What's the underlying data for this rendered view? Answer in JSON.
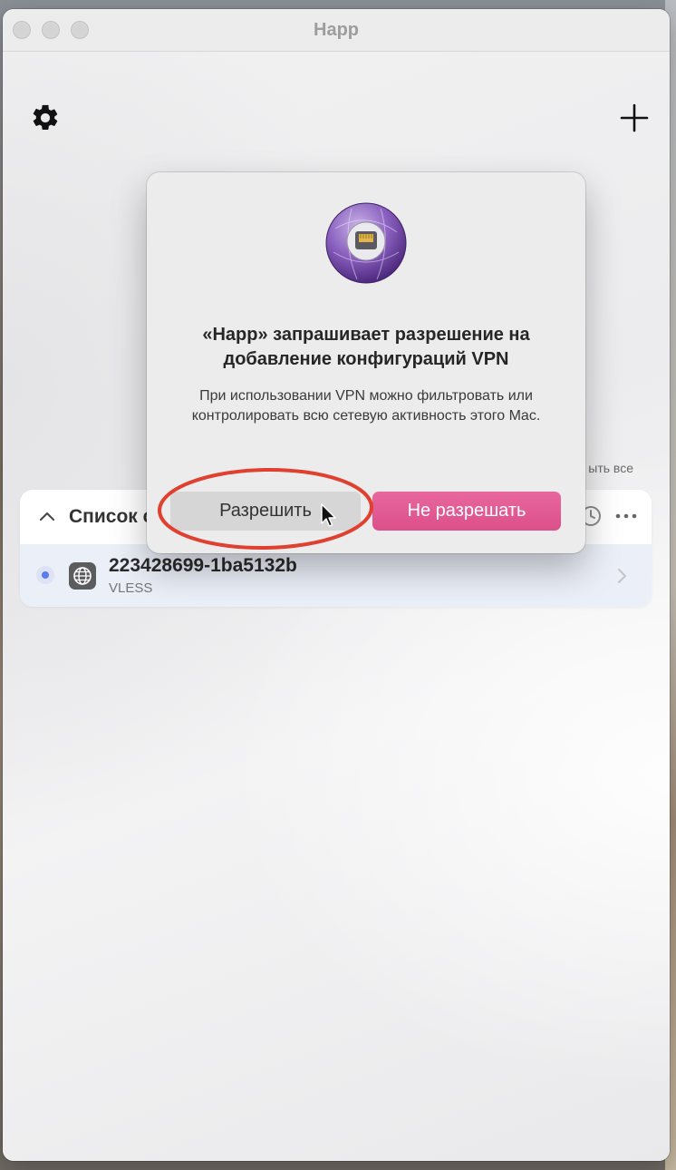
{
  "window": {
    "title": "Happ"
  },
  "toolbar": {
    "settings_icon": "gear-icon",
    "add_icon": "plus-icon"
  },
  "collapse_all": "ыть все",
  "server_list": {
    "title": "Список с",
    "servers": [
      {
        "name": "223428699-1ba5132b",
        "protocol": "VLESS",
        "selected": true
      }
    ]
  },
  "dialog": {
    "title": "«Happ» запрашивает разрешение на добавление конфигураций VPN",
    "body": "При использовании VPN можно фильтровать или контролировать всю сетевую активность этого Mac.",
    "allow_label": "Разрешить",
    "deny_label": "Не разрешать"
  },
  "colors": {
    "accent_pink": "#dc4f8a",
    "selected_dot": "#5b7cf0",
    "annotation_red": "#e0402f"
  }
}
